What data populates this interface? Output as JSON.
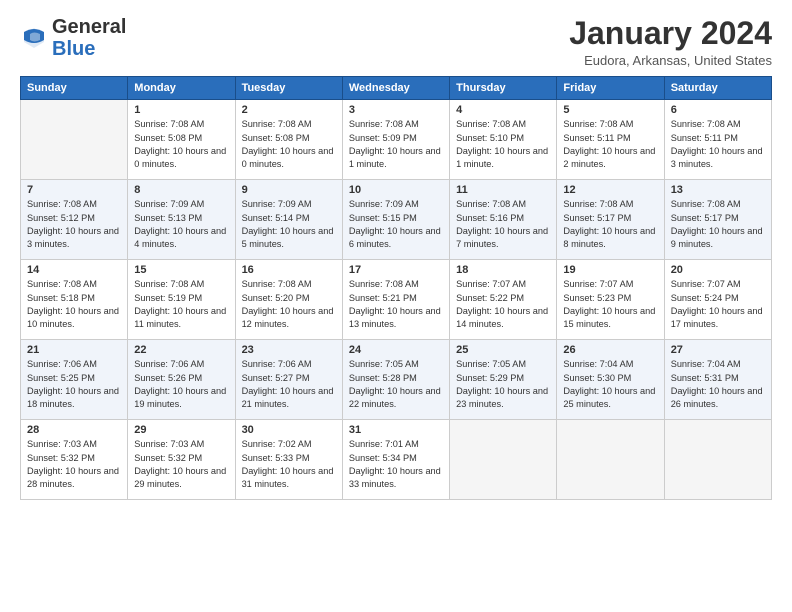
{
  "logo": {
    "line1": "General",
    "line2": "Blue"
  },
  "title": "January 2024",
  "location": "Eudora, Arkansas, United States",
  "headers": [
    "Sunday",
    "Monday",
    "Tuesday",
    "Wednesday",
    "Thursday",
    "Friday",
    "Saturday"
  ],
  "weeks": [
    [
      {
        "day": "",
        "sunrise": "",
        "sunset": "",
        "daylight": ""
      },
      {
        "day": "1",
        "sunrise": "Sunrise: 7:08 AM",
        "sunset": "Sunset: 5:08 PM",
        "daylight": "Daylight: 10 hours and 0 minutes."
      },
      {
        "day": "2",
        "sunrise": "Sunrise: 7:08 AM",
        "sunset": "Sunset: 5:08 PM",
        "daylight": "Daylight: 10 hours and 0 minutes."
      },
      {
        "day": "3",
        "sunrise": "Sunrise: 7:08 AM",
        "sunset": "Sunset: 5:09 PM",
        "daylight": "Daylight: 10 hours and 1 minute."
      },
      {
        "day": "4",
        "sunrise": "Sunrise: 7:08 AM",
        "sunset": "Sunset: 5:10 PM",
        "daylight": "Daylight: 10 hours and 1 minute."
      },
      {
        "day": "5",
        "sunrise": "Sunrise: 7:08 AM",
        "sunset": "Sunset: 5:11 PM",
        "daylight": "Daylight: 10 hours and 2 minutes."
      },
      {
        "day": "6",
        "sunrise": "Sunrise: 7:08 AM",
        "sunset": "Sunset: 5:11 PM",
        "daylight": "Daylight: 10 hours and 3 minutes."
      }
    ],
    [
      {
        "day": "7",
        "sunrise": "Sunrise: 7:08 AM",
        "sunset": "Sunset: 5:12 PM",
        "daylight": "Daylight: 10 hours and 3 minutes."
      },
      {
        "day": "8",
        "sunrise": "Sunrise: 7:09 AM",
        "sunset": "Sunset: 5:13 PM",
        "daylight": "Daylight: 10 hours and 4 minutes."
      },
      {
        "day": "9",
        "sunrise": "Sunrise: 7:09 AM",
        "sunset": "Sunset: 5:14 PM",
        "daylight": "Daylight: 10 hours and 5 minutes."
      },
      {
        "day": "10",
        "sunrise": "Sunrise: 7:09 AM",
        "sunset": "Sunset: 5:15 PM",
        "daylight": "Daylight: 10 hours and 6 minutes."
      },
      {
        "day": "11",
        "sunrise": "Sunrise: 7:08 AM",
        "sunset": "Sunset: 5:16 PM",
        "daylight": "Daylight: 10 hours and 7 minutes."
      },
      {
        "day": "12",
        "sunrise": "Sunrise: 7:08 AM",
        "sunset": "Sunset: 5:17 PM",
        "daylight": "Daylight: 10 hours and 8 minutes."
      },
      {
        "day": "13",
        "sunrise": "Sunrise: 7:08 AM",
        "sunset": "Sunset: 5:17 PM",
        "daylight": "Daylight: 10 hours and 9 minutes."
      }
    ],
    [
      {
        "day": "14",
        "sunrise": "Sunrise: 7:08 AM",
        "sunset": "Sunset: 5:18 PM",
        "daylight": "Daylight: 10 hours and 10 minutes."
      },
      {
        "day": "15",
        "sunrise": "Sunrise: 7:08 AM",
        "sunset": "Sunset: 5:19 PM",
        "daylight": "Daylight: 10 hours and 11 minutes."
      },
      {
        "day": "16",
        "sunrise": "Sunrise: 7:08 AM",
        "sunset": "Sunset: 5:20 PM",
        "daylight": "Daylight: 10 hours and 12 minutes."
      },
      {
        "day": "17",
        "sunrise": "Sunrise: 7:08 AM",
        "sunset": "Sunset: 5:21 PM",
        "daylight": "Daylight: 10 hours and 13 minutes."
      },
      {
        "day": "18",
        "sunrise": "Sunrise: 7:07 AM",
        "sunset": "Sunset: 5:22 PM",
        "daylight": "Daylight: 10 hours and 14 minutes."
      },
      {
        "day": "19",
        "sunrise": "Sunrise: 7:07 AM",
        "sunset": "Sunset: 5:23 PM",
        "daylight": "Daylight: 10 hours and 15 minutes."
      },
      {
        "day": "20",
        "sunrise": "Sunrise: 7:07 AM",
        "sunset": "Sunset: 5:24 PM",
        "daylight": "Daylight: 10 hours and 17 minutes."
      }
    ],
    [
      {
        "day": "21",
        "sunrise": "Sunrise: 7:06 AM",
        "sunset": "Sunset: 5:25 PM",
        "daylight": "Daylight: 10 hours and 18 minutes."
      },
      {
        "day": "22",
        "sunrise": "Sunrise: 7:06 AM",
        "sunset": "Sunset: 5:26 PM",
        "daylight": "Daylight: 10 hours and 19 minutes."
      },
      {
        "day": "23",
        "sunrise": "Sunrise: 7:06 AM",
        "sunset": "Sunset: 5:27 PM",
        "daylight": "Daylight: 10 hours and 21 minutes."
      },
      {
        "day": "24",
        "sunrise": "Sunrise: 7:05 AM",
        "sunset": "Sunset: 5:28 PM",
        "daylight": "Daylight: 10 hours and 22 minutes."
      },
      {
        "day": "25",
        "sunrise": "Sunrise: 7:05 AM",
        "sunset": "Sunset: 5:29 PM",
        "daylight": "Daylight: 10 hours and 23 minutes."
      },
      {
        "day": "26",
        "sunrise": "Sunrise: 7:04 AM",
        "sunset": "Sunset: 5:30 PM",
        "daylight": "Daylight: 10 hours and 25 minutes."
      },
      {
        "day": "27",
        "sunrise": "Sunrise: 7:04 AM",
        "sunset": "Sunset: 5:31 PM",
        "daylight": "Daylight: 10 hours and 26 minutes."
      }
    ],
    [
      {
        "day": "28",
        "sunrise": "Sunrise: 7:03 AM",
        "sunset": "Sunset: 5:32 PM",
        "daylight": "Daylight: 10 hours and 28 minutes."
      },
      {
        "day": "29",
        "sunrise": "Sunrise: 7:03 AM",
        "sunset": "Sunset: 5:32 PM",
        "daylight": "Daylight: 10 hours and 29 minutes."
      },
      {
        "day": "30",
        "sunrise": "Sunrise: 7:02 AM",
        "sunset": "Sunset: 5:33 PM",
        "daylight": "Daylight: 10 hours and 31 minutes."
      },
      {
        "day": "31",
        "sunrise": "Sunrise: 7:01 AM",
        "sunset": "Sunset: 5:34 PM",
        "daylight": "Daylight: 10 hours and 33 minutes."
      },
      {
        "day": "",
        "sunrise": "",
        "sunset": "",
        "daylight": ""
      },
      {
        "day": "",
        "sunrise": "",
        "sunset": "",
        "daylight": ""
      },
      {
        "day": "",
        "sunrise": "",
        "sunset": "",
        "daylight": ""
      }
    ]
  ]
}
